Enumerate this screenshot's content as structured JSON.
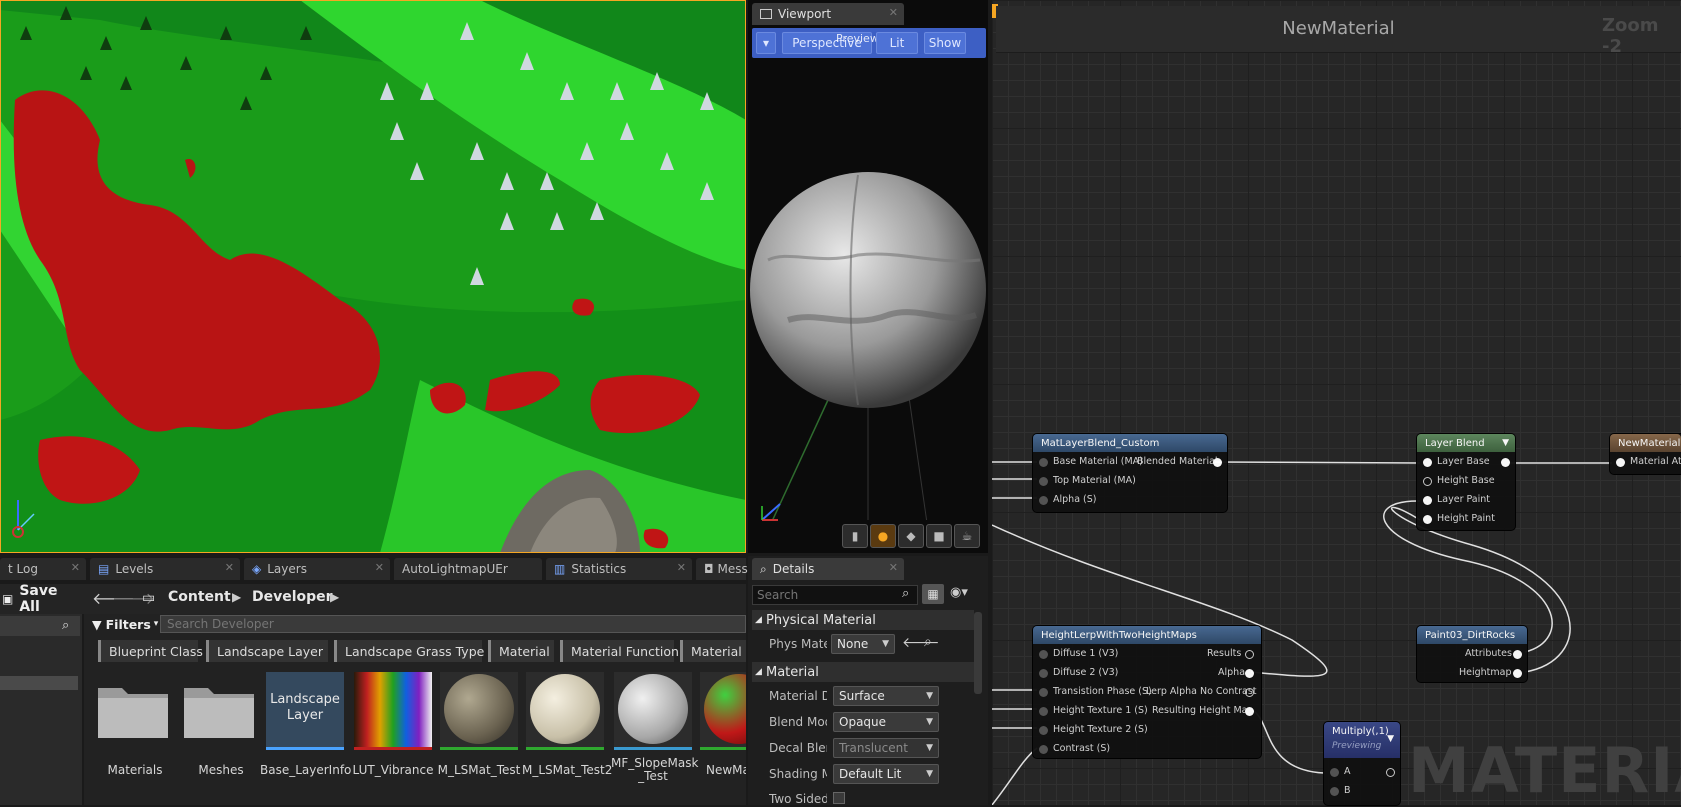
{
  "colors": {
    "accent": "#3d5fc4",
    "selection": "#f5a623",
    "graph_bg": "#262626",
    "node_header_blue": "#3f5f86",
    "node_header_green": "#4f7a4f",
    "node_header_brown": "#7a5c3f"
  },
  "level_viewport": {
    "axis_icon": "axis-gizmo-icon"
  },
  "material_viewport": {
    "tab_label": "Viewport",
    "toolbar": {
      "perspective": "Perspective",
      "previewing": "Previewin",
      "lit": "Lit",
      "show": "Show"
    },
    "bottom_tools": [
      "cylinder-icon",
      "sphere-icon",
      "plane-icon",
      "cube-icon",
      "teapot-icon"
    ]
  },
  "graph": {
    "title": "NewMaterial",
    "zoom": "Zoom -2",
    "watermark": "MATERIAL",
    "nodes": {
      "matlayerblend": {
        "title": "MatLayerBlend_Custom",
        "inputs": [
          "Base Material (MA)",
          "Top Material (MA)",
          "Alpha (S)"
        ],
        "outputs": [
          "Blended Material"
        ]
      },
      "layerblend": {
        "title": "Layer Blend",
        "inputs": [
          "Layer Base",
          "Height Base",
          "Layer Paint",
          "Height Paint"
        ]
      },
      "newmaterial": {
        "title": "NewMaterial",
        "inputs": [
          "Material Attri"
        ]
      },
      "heightlerp": {
        "title": "HeightLerpWithTwoHeightMaps",
        "inputs": [
          "Diffuse 1 (V3)",
          "Diffuse 2 (V3)",
          "Transistion Phase (S)",
          "Height Texture 1 (S)",
          "Height Texture 2 (S)",
          "Contrast (S)"
        ],
        "outputs": [
          "Results",
          "Alpha",
          "Lerp Alpha No Contrast",
          "Resulting Height Map"
        ]
      },
      "paint03": {
        "title": "Paint03_DirtRocks",
        "outputs": [
          "Attributes",
          "Heightmap"
        ]
      },
      "multiply": {
        "title": "Multiply(,1)",
        "subtitle": "Previewing",
        "inputs": [
          "A",
          "B"
        ]
      }
    }
  },
  "bottom_tabs": [
    {
      "label": "t Log"
    },
    {
      "label": "Levels"
    },
    {
      "label": "Layers"
    },
    {
      "label": "AutoLightmapUEr"
    },
    {
      "label": "Statistics"
    },
    {
      "label": "Mess"
    }
  ],
  "content_browser": {
    "save_all": "Save All",
    "breadcrumb": [
      "Content",
      "Developer"
    ],
    "filters_label": "Filters",
    "search_placeholder": "Search Developer",
    "filter_chips": [
      "Blueprint Class",
      "Landscape Layer",
      "Landscape Grass Type",
      "Material",
      "Material Function",
      "Material In"
    ],
    "assets": [
      {
        "name": "Materials",
        "kind": "folder"
      },
      {
        "name": "Meshes",
        "kind": "folder"
      },
      {
        "name": "Base_LayerInfo",
        "kind": "landscape-layer",
        "thumb_text": "Landscape Layer"
      },
      {
        "name": "LUT_Vibrance",
        "kind": "texture"
      },
      {
        "name": "M_LSMat_Test",
        "kind": "material"
      },
      {
        "name": "M_LSMat_Test2",
        "kind": "material"
      },
      {
        "name": "MF_SlopeMask _Test",
        "kind": "material-function"
      },
      {
        "name": "NewMa",
        "kind": "material"
      }
    ]
  },
  "details": {
    "tab_label": "Details",
    "search_placeholder": "Search",
    "sections": {
      "physical": "Physical Material",
      "material": "Material"
    },
    "props": [
      {
        "label": "Phys Mater",
        "value": "None"
      },
      {
        "label": "Material Do",
        "value": "Surface"
      },
      {
        "label": "Blend Mode",
        "value": "Opaque"
      },
      {
        "label": "Decal Blenc",
        "value": "Translucent"
      },
      {
        "label": "Shading Mc",
        "value": "Default Lit"
      },
      {
        "label": "Two Sided",
        "value": ""
      }
    ]
  }
}
